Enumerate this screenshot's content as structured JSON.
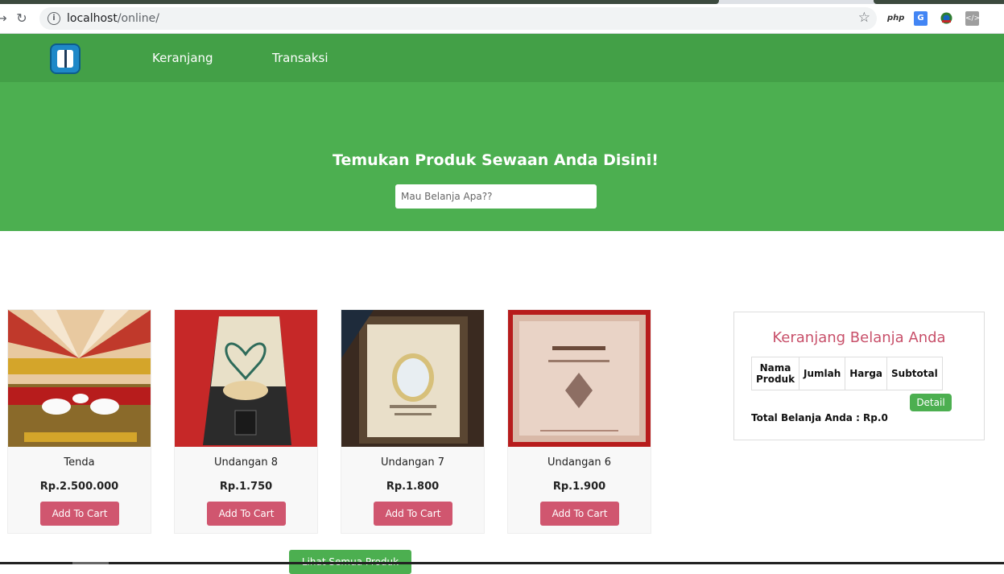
{
  "browser": {
    "url_host": "localhost",
    "url_path": "/online/",
    "extensions": [
      "php",
      "G",
      "globe",
      "</>"
    ]
  },
  "header": {
    "nav": [
      "Keranjang",
      "Transaksi"
    ]
  },
  "hero": {
    "title": "Temukan Produk Sewaan Anda Disini!",
    "search_placeholder": "Mau Belanja Apa??"
  },
  "products": [
    {
      "name": "Tenda",
      "price": "Rp.2.500.000",
      "button": "Add To Cart"
    },
    {
      "name": "Undangan 8",
      "price": "Rp.1.750",
      "button": "Add To Cart"
    },
    {
      "name": "Undangan 7",
      "price": "Rp.1.800",
      "button": "Add To Cart"
    },
    {
      "name": "Undangan 6",
      "price": "Rp.1.900",
      "button": "Add To Cart"
    }
  ],
  "cart": {
    "title": "Keranjang Belanja Anda",
    "columns": [
      "Nama Produk",
      "Jumlah",
      "Harga",
      "Subtotal"
    ],
    "detail_label": "Detail",
    "total_label": "Total Belanja Anda : Rp.0"
  },
  "all_products_label": "Lihat Semua Produk",
  "colors": {
    "header_green": "#43a047",
    "hero_green": "#4caf50",
    "accent_pink": "#d0566f"
  }
}
